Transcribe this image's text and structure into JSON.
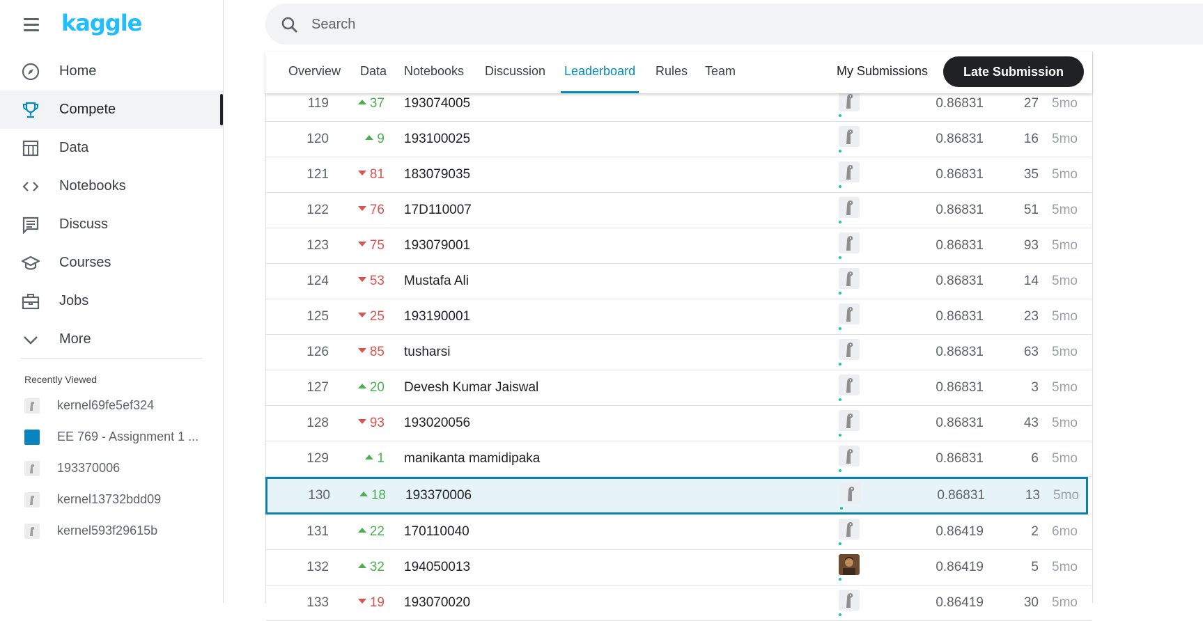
{
  "sidebar": {
    "logo": "kaggle",
    "nav": [
      {
        "label": "Home",
        "icon": "compass-icon"
      },
      {
        "label": "Compete",
        "icon": "trophy-icon",
        "active": true
      },
      {
        "label": "Data",
        "icon": "table-icon"
      },
      {
        "label": "Notebooks",
        "icon": "code-icon"
      },
      {
        "label": "Discuss",
        "icon": "comment-icon"
      },
      {
        "label": "Courses",
        "icon": "school-icon"
      },
      {
        "label": "Jobs",
        "icon": "briefcase-icon"
      },
      {
        "label": "More",
        "icon": "chevron-down-icon"
      }
    ],
    "recent_title": "Recently Viewed",
    "recent": [
      {
        "label": "kernel69fe5ef324",
        "icon": "kernel-thumbnail-icon"
      },
      {
        "label": "EE 769 - Assignment 1 ...",
        "icon": "competition-thumbnail-icon"
      },
      {
        "label": "193370006",
        "icon": "kernel-thumbnail-icon"
      },
      {
        "label": "kernel13732bdd09",
        "icon": "kernel-thumbnail-icon"
      },
      {
        "label": "kernel593f29615b",
        "icon": "kernel-thumbnail-icon"
      }
    ]
  },
  "search": {
    "placeholder": "Search"
  },
  "tabs": [
    {
      "label": "Overview"
    },
    {
      "label": "Data"
    },
    {
      "label": "Notebooks"
    },
    {
      "label": "Discussion"
    },
    {
      "label": "Leaderboard",
      "active": true
    },
    {
      "label": "Rules"
    },
    {
      "label": "Team"
    }
  ],
  "my_submissions_label": "My Submissions",
  "late_submission_label": "Late Submission",
  "colors": {
    "accent": "#008abc",
    "up": "#4caf50",
    "down": "#d9534f",
    "highlight_bg": "#e6f3f8",
    "highlight_border": "#0e7fab"
  },
  "leaderboard": [
    {
      "rank": "119",
      "dir": "up",
      "change": "37",
      "team": "193074005",
      "score": "0.86831",
      "entries": "27",
      "last": "5mo"
    },
    {
      "rank": "120",
      "dir": "up",
      "change": "9",
      "team": "193100025",
      "score": "0.86831",
      "entries": "16",
      "last": "5mo"
    },
    {
      "rank": "121",
      "dir": "down",
      "change": "81",
      "team": "183079035",
      "score": "0.86831",
      "entries": "35",
      "last": "5mo"
    },
    {
      "rank": "122",
      "dir": "down",
      "change": "76",
      "team": "17D110007",
      "score": "0.86831",
      "entries": "51",
      "last": "5mo"
    },
    {
      "rank": "123",
      "dir": "down",
      "change": "75",
      "team": "193079001",
      "score": "0.86831",
      "entries": "93",
      "last": "5mo"
    },
    {
      "rank": "124",
      "dir": "down",
      "change": "53",
      "team": "Mustafa Ali",
      "score": "0.86831",
      "entries": "14",
      "last": "5mo"
    },
    {
      "rank": "125",
      "dir": "down",
      "change": "25",
      "team": "193190001",
      "score": "0.86831",
      "entries": "23",
      "last": "5mo"
    },
    {
      "rank": "126",
      "dir": "down",
      "change": "85",
      "team": "tusharsi",
      "score": "0.86831",
      "entries": "63",
      "last": "5mo"
    },
    {
      "rank": "127",
      "dir": "up",
      "change": "20",
      "team": "Devesh Kumar Jaiswal",
      "score": "0.86831",
      "entries": "3",
      "last": "5mo"
    },
    {
      "rank": "128",
      "dir": "down",
      "change": "93",
      "team": "193020056",
      "score": "0.86831",
      "entries": "43",
      "last": "5mo"
    },
    {
      "rank": "129",
      "dir": "up",
      "change": "1",
      "team": "manikanta mamidipaka",
      "score": "0.86831",
      "entries": "6",
      "last": "5mo"
    },
    {
      "rank": "130",
      "dir": "up",
      "change": "18",
      "team": "193370006",
      "score": "0.86831",
      "entries": "13",
      "last": "5mo",
      "highlight": true
    },
    {
      "rank": "131",
      "dir": "up",
      "change": "22",
      "team": "170110040",
      "score": "0.86419",
      "entries": "2",
      "last": "6mo"
    },
    {
      "rank": "132",
      "dir": "up",
      "change": "32",
      "team": "194050013",
      "score": "0.86419",
      "entries": "5",
      "last": "5mo",
      "photo": true
    },
    {
      "rank": "133",
      "dir": "down",
      "change": "19",
      "team": "193070020",
      "score": "0.86419",
      "entries": "30",
      "last": "5mo"
    }
  ]
}
